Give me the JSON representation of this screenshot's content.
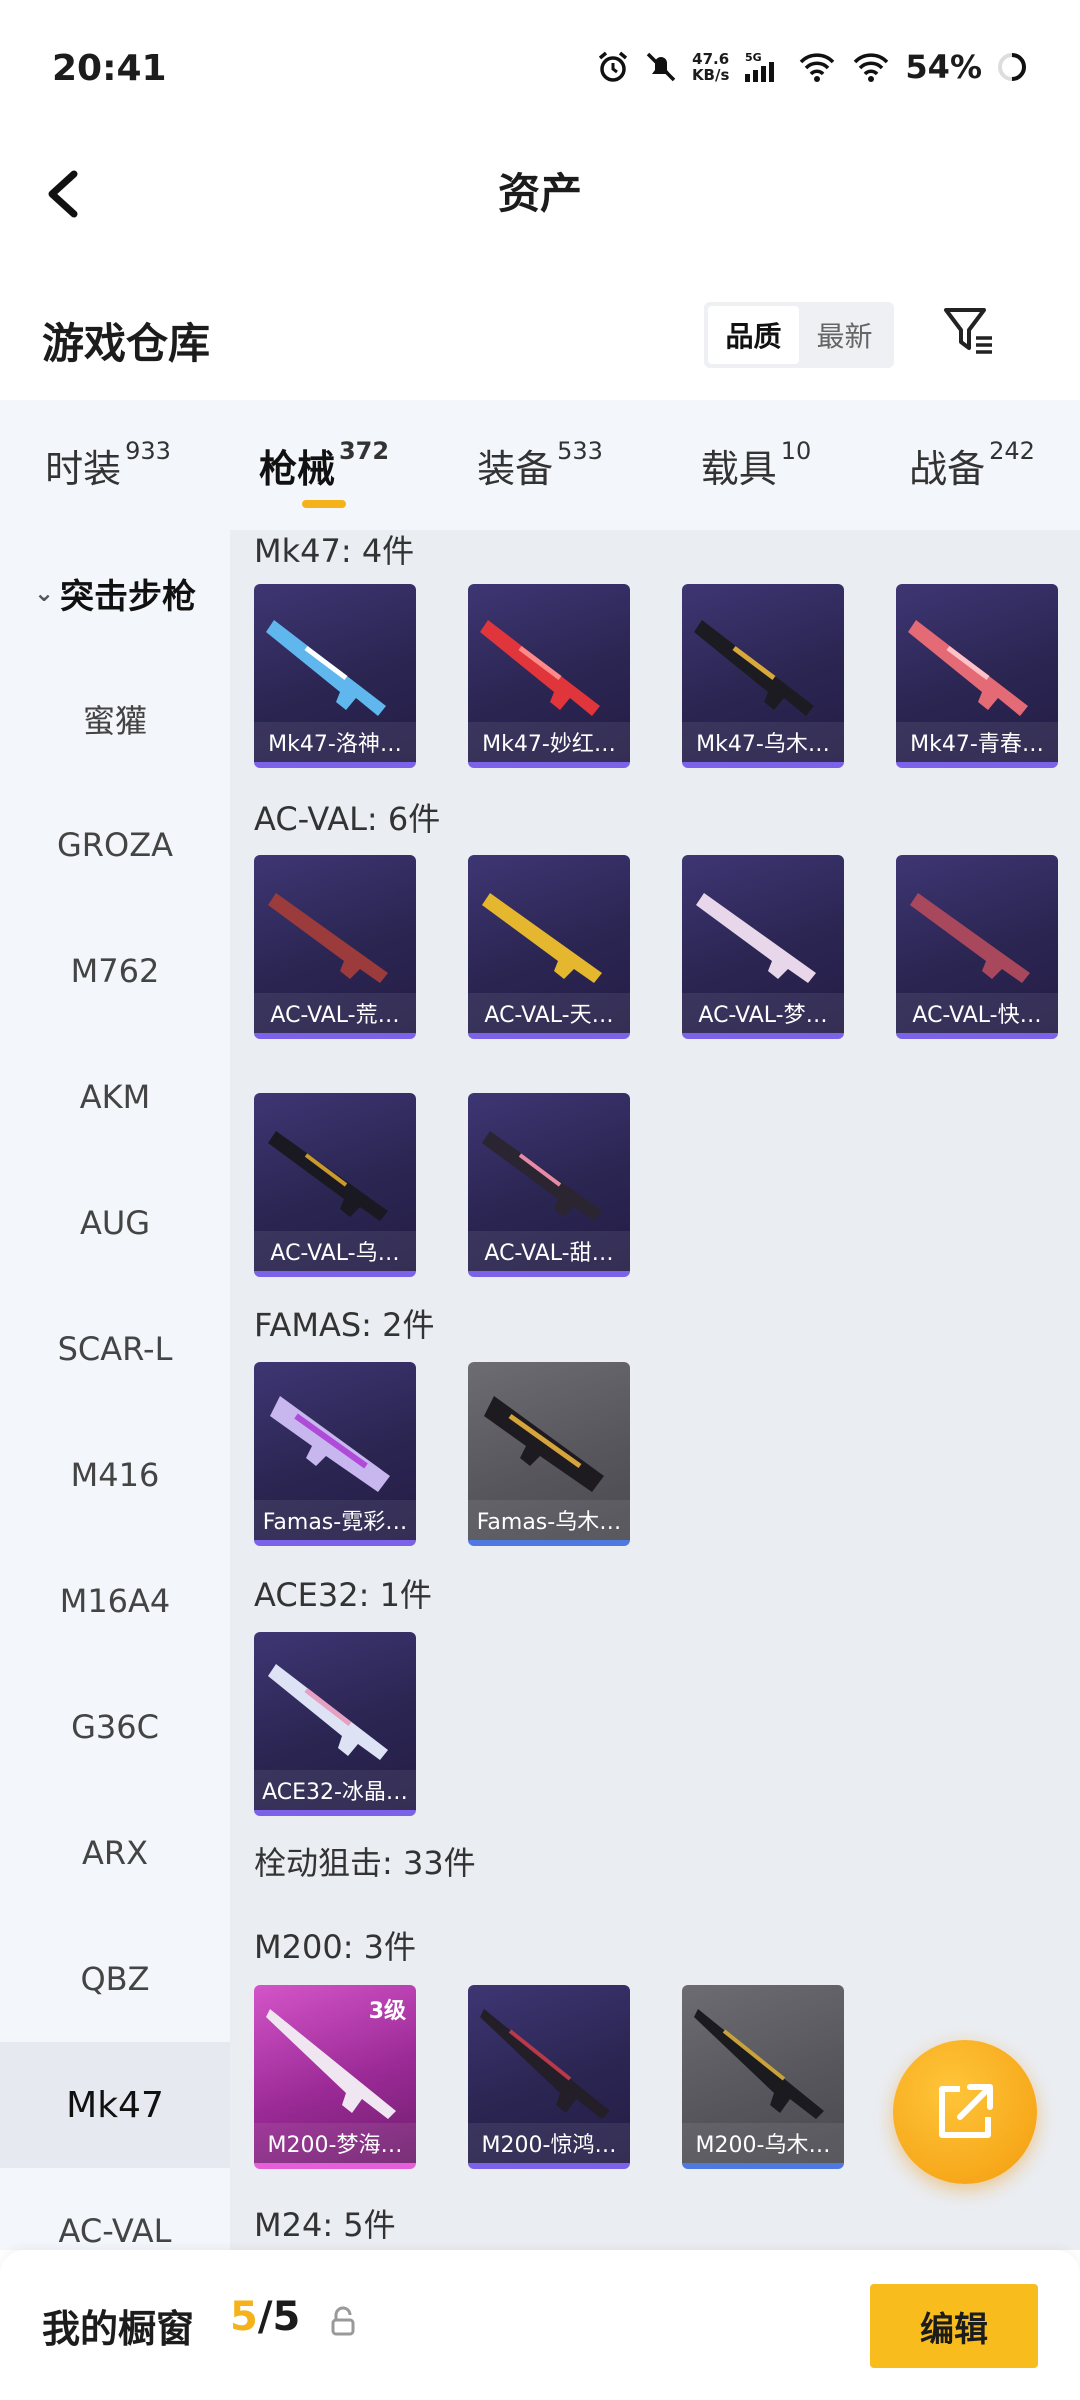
{
  "status": {
    "time": "20:41",
    "net_speed": "47.6",
    "net_unit": "KB/s",
    "net_type": "5G",
    "battery": "54%"
  },
  "header": {
    "title": "资产"
  },
  "warehouse": {
    "title": "游戏仓库",
    "sort_quality": "品质",
    "sort_latest": "最新"
  },
  "tabs": [
    {
      "label": "时装",
      "count": "933"
    },
    {
      "label": "枪械",
      "count": "372"
    },
    {
      "label": "装备",
      "count": "533"
    },
    {
      "label": "载具",
      "count": "10"
    },
    {
      "label": "战备",
      "count": "242"
    }
  ],
  "sidebar": {
    "category": "突击步枪",
    "items": [
      "蜜獾",
      "GROZA",
      "M762",
      "AKM",
      "AUG",
      "SCAR-L",
      "M416",
      "M16A4",
      "G36C",
      "ARX",
      "QBZ",
      "Mk47",
      "AC-VAL"
    ]
  },
  "groups": [
    {
      "title": "Mk47: 4件",
      "items": [
        "Mk47-洛神…",
        "Mk47-妙红…",
        "Mk47-乌木…",
        "Mk47-青春…"
      ]
    },
    {
      "title": "AC-VAL: 6件",
      "items": [
        "AC-VAL-荒…",
        "AC-VAL-天…",
        "AC-VAL-梦…",
        "AC-VAL-快…",
        "AC-VAL-乌…",
        "AC-VAL-甜…"
      ]
    },
    {
      "title": "FAMAS: 2件",
      "items": [
        "Famas-霓彩…",
        "Famas-乌木…"
      ]
    },
    {
      "title": "ACE32: 1件",
      "items": [
        "ACE32-冰晶…"
      ]
    },
    {
      "title": "栓动狙击: 33件"
    },
    {
      "title": "M200: 3件",
      "items": [
        "M200-梦海…",
        "M200-惊鸿…",
        "M200-乌木…"
      ],
      "level": "3级"
    },
    {
      "title": "M24: 5件"
    }
  ],
  "bottom": {
    "label": "我的橱窗",
    "current": "5",
    "total": "/5",
    "edit": "编辑"
  },
  "colors": {
    "accent": "#f5b21b",
    "card_purple": "#2b2552",
    "card_pink": "#9b2a96",
    "card_gray": "#55555b"
  }
}
